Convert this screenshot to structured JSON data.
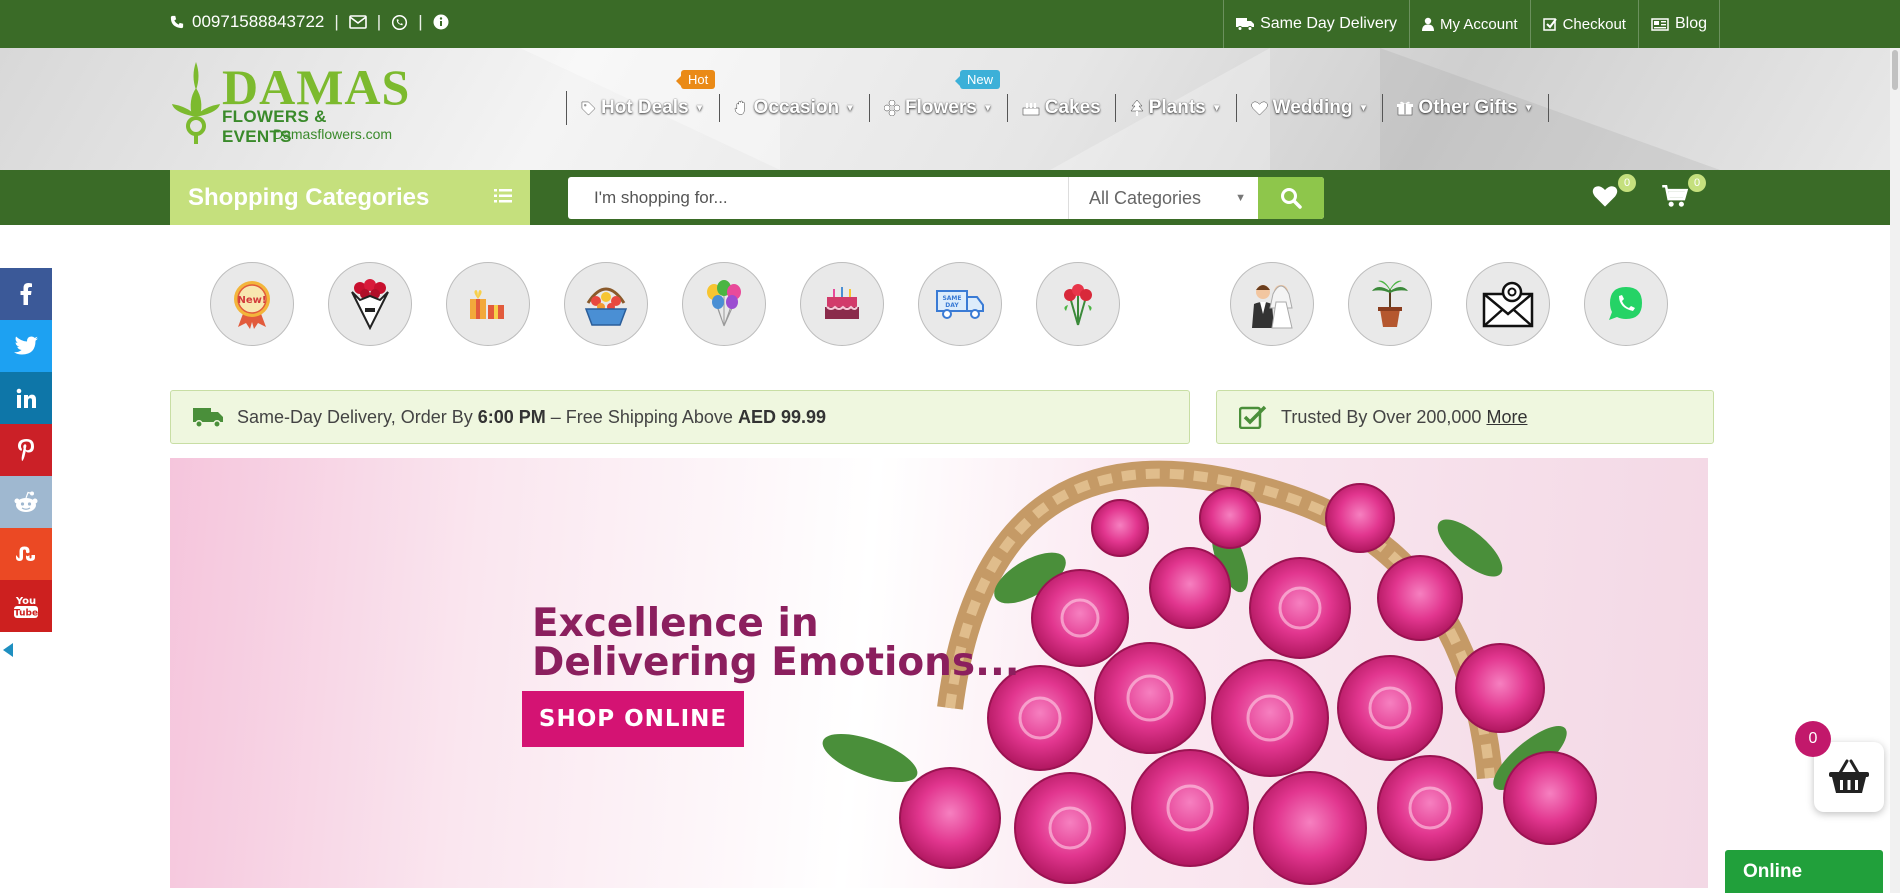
{
  "topbar": {
    "phone": "00971588843722",
    "separator": "|",
    "links": {
      "same_day_delivery": "Same Day Delivery",
      "my_account": "My Account",
      "checkout": "Checkout",
      "blog": "Blog"
    }
  },
  "logo": {
    "brand": "DAMAS",
    "subtitle": "FLOWERS & EVENTS",
    "url": "Damasflowers.com"
  },
  "nav": {
    "hot_deals": "Hot Deals",
    "hot_badge": "Hot",
    "occasion": "Occasion",
    "flowers": "Flowers",
    "new_badge": "New",
    "cakes": "Cakes",
    "plants": "Plants",
    "wedding": "Wedding",
    "other_gifts": "Other Gifts"
  },
  "search": {
    "categories_label": "Shopping Categories",
    "placeholder": "I'm shopping for...",
    "category_select": "All Categories",
    "wishlist_count": "0",
    "cart_count": "0"
  },
  "category_icons": [
    "new-badge-icon",
    "bouquet-icon",
    "gift-icon",
    "flower-basket-icon",
    "balloons-icon",
    "cake-icon",
    "same-day-truck-icon",
    "roses-icon",
    "wedding-couple-icon",
    "plant-icon",
    "email-icon",
    "whatsapp-icon"
  ],
  "info": {
    "delivery_prefix": "Same-Day Delivery, Order By",
    "delivery_time": "6:00 PM",
    "delivery_middle": "– Free Shipping Above",
    "delivery_amount": "AED 99.99",
    "trusted_text": "Trusted By Over 200,000",
    "more_link": "More"
  },
  "hero": {
    "title_line1": "Excellence in",
    "title_line2": "Delivering Emotions...",
    "cta": "SHOP ONLINE"
  },
  "social": [
    "facebook-icon",
    "twitter-icon",
    "linkedin-icon",
    "pinterest-icon",
    "reddit-icon",
    "stumbleupon-icon",
    "youtube-icon"
  ],
  "widgets": {
    "cart_badge": "0",
    "chat_status": "Online"
  },
  "colors": {
    "primary_green": "#3a6b27",
    "light_green": "#c5e07d",
    "accent_pink": "#d41373",
    "hero_title": "#8b1f5e"
  }
}
